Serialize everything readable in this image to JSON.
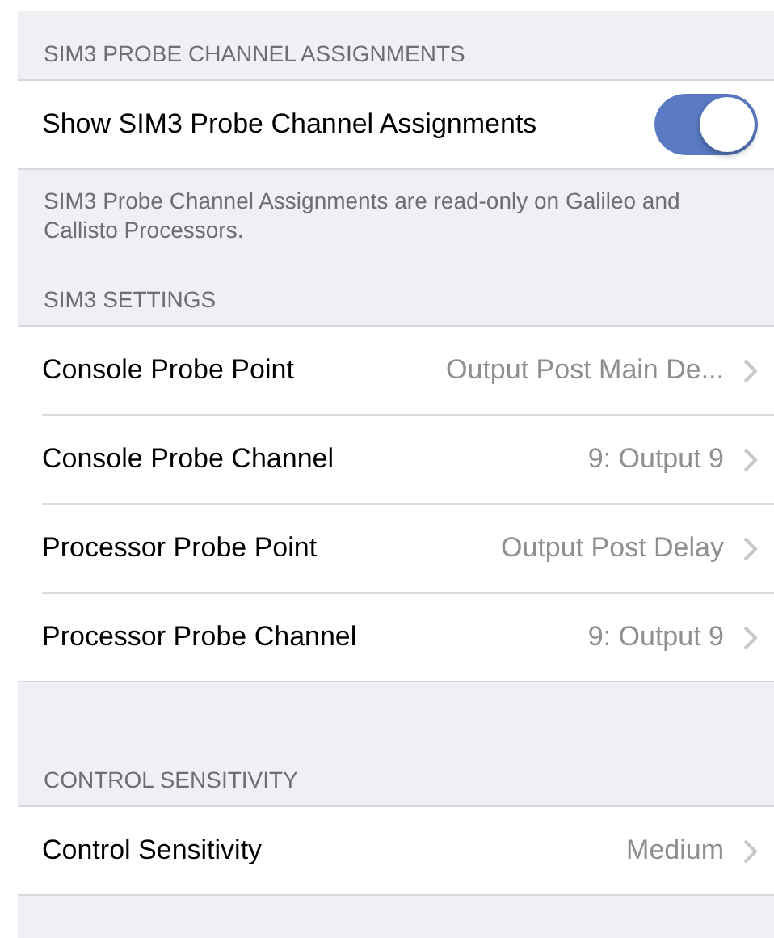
{
  "sections": [
    {
      "header": "SIM3 PROBE CHANNEL ASSIGNMENTS",
      "rows": [
        {
          "kind": "toggle",
          "label": "Show SIM3 Probe Channel Assignments",
          "on": true
        }
      ],
      "footer": "SIM3 Probe Channel Assignments are read-only on Galileo and Callisto Processors."
    },
    {
      "header": "SIM3 SETTINGS",
      "rows": [
        {
          "kind": "detail",
          "label": "Console Probe Point",
          "value": "Output Post Main De..."
        },
        {
          "kind": "detail",
          "label": "Console Probe Channel",
          "value": "9: Output 9"
        },
        {
          "kind": "detail",
          "label": "Processor Probe Point",
          "value": "Output Post Delay"
        },
        {
          "kind": "detail",
          "label": "Processor Probe Channel",
          "value": "9: Output 9"
        }
      ]
    },
    {
      "header": "CONTROL SENSITIVITY",
      "rows": [
        {
          "kind": "detail",
          "label": "Control Sensitivity",
          "value": "Medium"
        }
      ]
    }
  ]
}
